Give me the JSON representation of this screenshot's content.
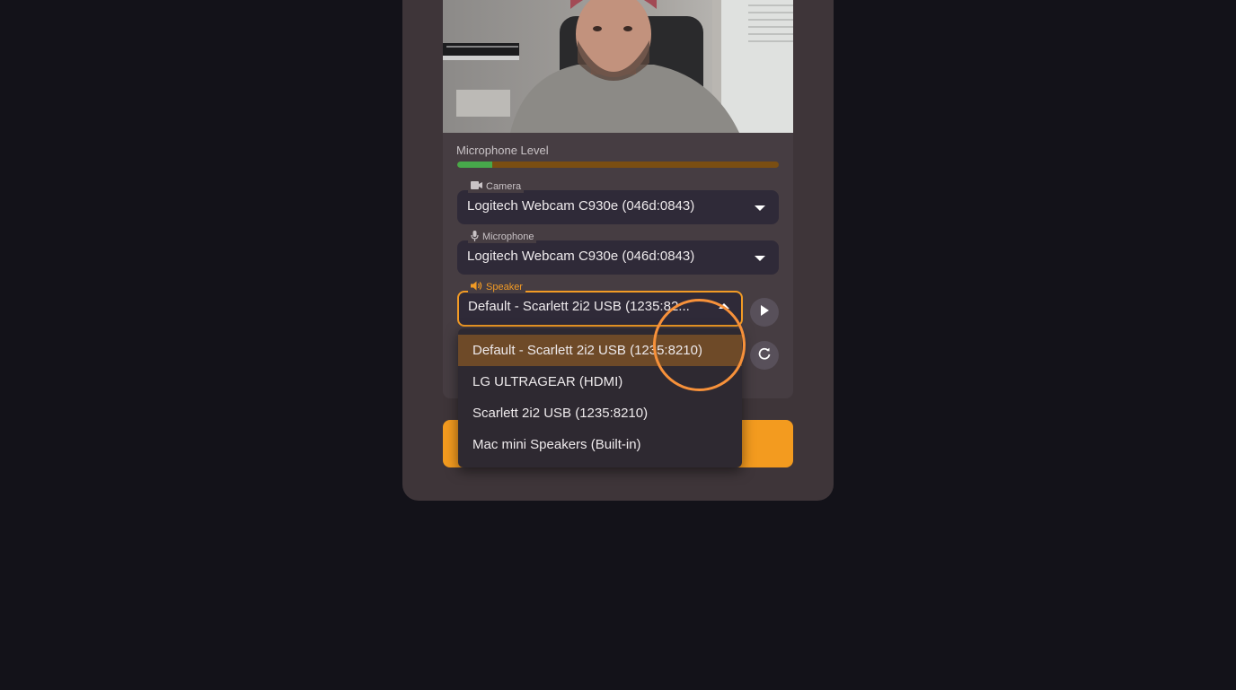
{
  "preview": {
    "microphone_level_label": "Microphone Level",
    "microphone_level_fraction": 0.11
  },
  "camera": {
    "label": "Camera",
    "value": "Logitech Webcam C930e (046d:0843)"
  },
  "microphone": {
    "label": "Microphone",
    "value": "Logitech Webcam C930e (046d:0843)"
  },
  "speaker": {
    "label": "Speaker",
    "value": "Default - Scarlett 2i2 USB (1235:82...",
    "options": [
      {
        "label": "Default - Scarlett 2i2 USB (1235:8210)",
        "selected": true
      },
      {
        "label": "LG ULTRAGEAR (HDMI)",
        "selected": false
      },
      {
        "label": "Scarlett 2i2 USB (1235:8210)",
        "selected": false
      },
      {
        "label": "Mac mini Speakers (Built-in)",
        "selected": false
      }
    ]
  },
  "icons": {
    "camera": "videocam-icon",
    "microphone": "mic-icon",
    "speaker": "volume-icon",
    "play": "play-icon",
    "refresh": "refresh-icon",
    "dropdown": "caret-down-icon"
  },
  "colors": {
    "accent": "#f29b25",
    "level_fill": "#47a94b",
    "level_track": "#7a4e12",
    "background": "#131219",
    "card": "#3e3539"
  }
}
